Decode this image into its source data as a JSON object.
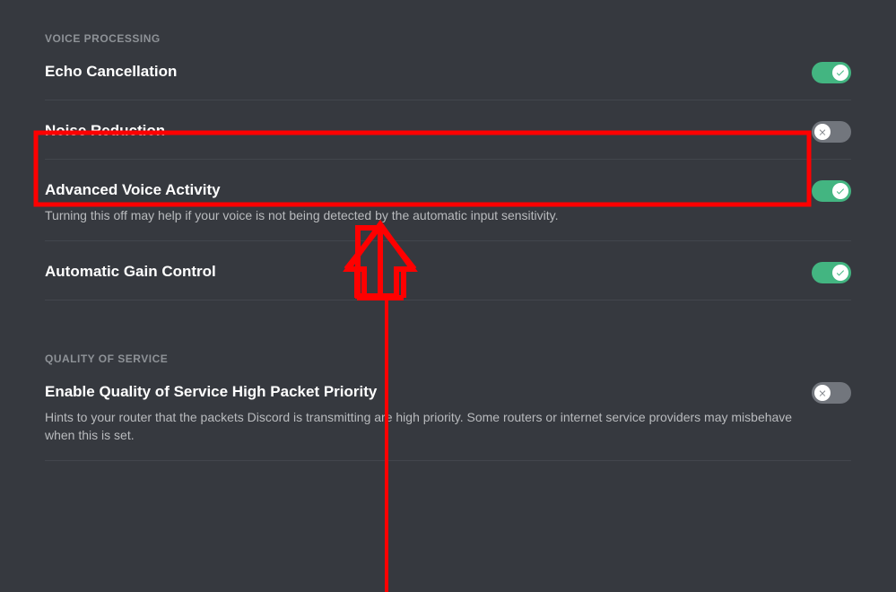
{
  "voice_processing": {
    "header": "VOICE PROCESSING",
    "echo": {
      "title": "Echo Cancellation",
      "on": true
    },
    "noise": {
      "title": "Noise Reduction",
      "on": false
    },
    "adv_voice": {
      "title": "Advanced Voice Activity",
      "desc": "Turning this off may help if your voice is not being detected by the automatic input sensitivity.",
      "on": true
    },
    "agc": {
      "title": "Automatic Gain Control",
      "on": true
    }
  },
  "qos": {
    "header": "QUALITY OF SERVICE",
    "hpp": {
      "title": "Enable Quality of Service High Packet Priority",
      "desc": "Hints to your router that the packets Discord is transmitting are high priority. Some routers or internet service providers may misbehave when this is set.",
      "on": false
    }
  }
}
